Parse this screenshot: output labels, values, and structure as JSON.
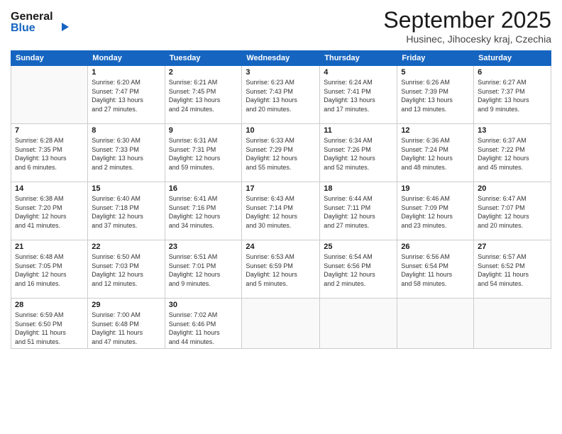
{
  "logo": {
    "line1": "General",
    "line2": "Blue"
  },
  "title": "September 2025",
  "location": "Husinec, Jihocesky kraj, Czechia",
  "days_header": [
    "Sunday",
    "Monday",
    "Tuesday",
    "Wednesday",
    "Thursday",
    "Friday",
    "Saturday"
  ],
  "weeks": [
    [
      {
        "day": "",
        "info": ""
      },
      {
        "day": "1",
        "info": "Sunrise: 6:20 AM\nSunset: 7:47 PM\nDaylight: 13 hours\nand 27 minutes."
      },
      {
        "day": "2",
        "info": "Sunrise: 6:21 AM\nSunset: 7:45 PM\nDaylight: 13 hours\nand 24 minutes."
      },
      {
        "day": "3",
        "info": "Sunrise: 6:23 AM\nSunset: 7:43 PM\nDaylight: 13 hours\nand 20 minutes."
      },
      {
        "day": "4",
        "info": "Sunrise: 6:24 AM\nSunset: 7:41 PM\nDaylight: 13 hours\nand 17 minutes."
      },
      {
        "day": "5",
        "info": "Sunrise: 6:26 AM\nSunset: 7:39 PM\nDaylight: 13 hours\nand 13 minutes."
      },
      {
        "day": "6",
        "info": "Sunrise: 6:27 AM\nSunset: 7:37 PM\nDaylight: 13 hours\nand 9 minutes."
      }
    ],
    [
      {
        "day": "7",
        "info": "Sunrise: 6:28 AM\nSunset: 7:35 PM\nDaylight: 13 hours\nand 6 minutes."
      },
      {
        "day": "8",
        "info": "Sunrise: 6:30 AM\nSunset: 7:33 PM\nDaylight: 13 hours\nand 2 minutes."
      },
      {
        "day": "9",
        "info": "Sunrise: 6:31 AM\nSunset: 7:31 PM\nDaylight: 12 hours\nand 59 minutes."
      },
      {
        "day": "10",
        "info": "Sunrise: 6:33 AM\nSunset: 7:29 PM\nDaylight: 12 hours\nand 55 minutes."
      },
      {
        "day": "11",
        "info": "Sunrise: 6:34 AM\nSunset: 7:26 PM\nDaylight: 12 hours\nand 52 minutes."
      },
      {
        "day": "12",
        "info": "Sunrise: 6:36 AM\nSunset: 7:24 PM\nDaylight: 12 hours\nand 48 minutes."
      },
      {
        "day": "13",
        "info": "Sunrise: 6:37 AM\nSunset: 7:22 PM\nDaylight: 12 hours\nand 45 minutes."
      }
    ],
    [
      {
        "day": "14",
        "info": "Sunrise: 6:38 AM\nSunset: 7:20 PM\nDaylight: 12 hours\nand 41 minutes."
      },
      {
        "day": "15",
        "info": "Sunrise: 6:40 AM\nSunset: 7:18 PM\nDaylight: 12 hours\nand 37 minutes."
      },
      {
        "day": "16",
        "info": "Sunrise: 6:41 AM\nSunset: 7:16 PM\nDaylight: 12 hours\nand 34 minutes."
      },
      {
        "day": "17",
        "info": "Sunrise: 6:43 AM\nSunset: 7:14 PM\nDaylight: 12 hours\nand 30 minutes."
      },
      {
        "day": "18",
        "info": "Sunrise: 6:44 AM\nSunset: 7:11 PM\nDaylight: 12 hours\nand 27 minutes."
      },
      {
        "day": "19",
        "info": "Sunrise: 6:46 AM\nSunset: 7:09 PM\nDaylight: 12 hours\nand 23 minutes."
      },
      {
        "day": "20",
        "info": "Sunrise: 6:47 AM\nSunset: 7:07 PM\nDaylight: 12 hours\nand 20 minutes."
      }
    ],
    [
      {
        "day": "21",
        "info": "Sunrise: 6:48 AM\nSunset: 7:05 PM\nDaylight: 12 hours\nand 16 minutes."
      },
      {
        "day": "22",
        "info": "Sunrise: 6:50 AM\nSunset: 7:03 PM\nDaylight: 12 hours\nand 12 minutes."
      },
      {
        "day": "23",
        "info": "Sunrise: 6:51 AM\nSunset: 7:01 PM\nDaylight: 12 hours\nand 9 minutes."
      },
      {
        "day": "24",
        "info": "Sunrise: 6:53 AM\nSunset: 6:59 PM\nDaylight: 12 hours\nand 5 minutes."
      },
      {
        "day": "25",
        "info": "Sunrise: 6:54 AM\nSunset: 6:56 PM\nDaylight: 12 hours\nand 2 minutes."
      },
      {
        "day": "26",
        "info": "Sunrise: 6:56 AM\nSunset: 6:54 PM\nDaylight: 11 hours\nand 58 minutes."
      },
      {
        "day": "27",
        "info": "Sunrise: 6:57 AM\nSunset: 6:52 PM\nDaylight: 11 hours\nand 54 minutes."
      }
    ],
    [
      {
        "day": "28",
        "info": "Sunrise: 6:59 AM\nSunset: 6:50 PM\nDaylight: 11 hours\nand 51 minutes."
      },
      {
        "day": "29",
        "info": "Sunrise: 7:00 AM\nSunset: 6:48 PM\nDaylight: 11 hours\nand 47 minutes."
      },
      {
        "day": "30",
        "info": "Sunrise: 7:02 AM\nSunset: 6:46 PM\nDaylight: 11 hours\nand 44 minutes."
      },
      {
        "day": "",
        "info": ""
      },
      {
        "day": "",
        "info": ""
      },
      {
        "day": "",
        "info": ""
      },
      {
        "day": "",
        "info": ""
      }
    ]
  ]
}
